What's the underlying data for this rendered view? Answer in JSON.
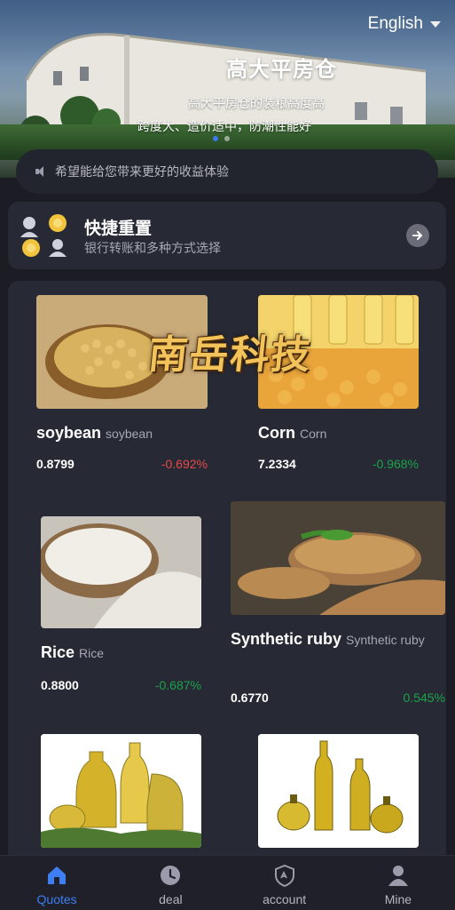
{
  "banner": {
    "title": "高大平房仓",
    "subtitle_line1": "高大平房仓的装粮高度高",
    "subtitle_line2": "跨度大、造价适中，防潮性能好",
    "language": "English"
  },
  "notice": {
    "text": "希望能给您带来更好的收益体验"
  },
  "quick": {
    "title": "快捷重置",
    "subtitle": "银行转账和多种方式选择"
  },
  "watermark": {
    "text": "南岳科技"
  },
  "products": [
    {
      "name": "soybean",
      "alt": "soybean",
      "price": "0.8799",
      "change": "-0.692%",
      "trend": "down"
    },
    {
      "name": "Corn",
      "alt": "Corn",
      "price": "7.2334",
      "change": "-0.968%",
      "trend": "up"
    },
    {
      "name": "Rice",
      "alt": "Rice",
      "price": "0.8800",
      "change": "-0.687%",
      "trend": "up"
    },
    {
      "name": "Synthetic ruby",
      "alt": "Synthetic ruby",
      "price": "0.6770",
      "change": "0.545%",
      "trend": "up"
    }
  ],
  "tabs": [
    {
      "label": "Quotes",
      "icon": "home-icon",
      "active": true
    },
    {
      "label": "deal",
      "icon": "clock-icon",
      "active": false
    },
    {
      "label": "account",
      "icon": "shield-icon",
      "active": false
    },
    {
      "label": "Mine",
      "icon": "user-icon",
      "active": false
    }
  ],
  "colors": {
    "accent": "#3d7ef3",
    "negative": "#e84a4a",
    "positive": "#19a34a",
    "background": "#1b1c24",
    "card": "#272934"
  }
}
